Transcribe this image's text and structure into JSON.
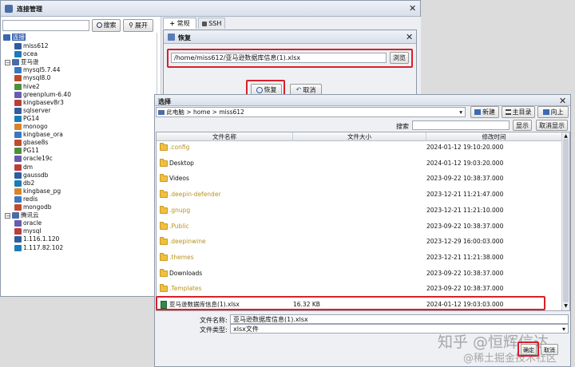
{
  "conn_mgr": {
    "title": "连接管理",
    "search_label": "搜索",
    "expand_label": "展开",
    "search_value": ""
  },
  "tree": {
    "root": "连接",
    "items": [
      {
        "label": "miss612",
        "depth": 1
      },
      {
        "label": "ocea",
        "depth": 1
      },
      {
        "label": "亚马逊",
        "depth": 0,
        "group": true
      },
      {
        "label": "mysql5.7.44",
        "depth": 1
      },
      {
        "label": "mysql8.0",
        "depth": 1
      },
      {
        "label": "hive2",
        "depth": 1
      },
      {
        "label": "greenplum-6.40",
        "depth": 1
      },
      {
        "label": "kingbasev8r3",
        "depth": 1
      },
      {
        "label": "sqlserver",
        "depth": 1
      },
      {
        "label": "PG14",
        "depth": 1
      },
      {
        "label": "monogo",
        "depth": 1
      },
      {
        "label": "kingbase_ora",
        "depth": 1
      },
      {
        "label": "gbase8s",
        "depth": 1
      },
      {
        "label": "PG11",
        "depth": 1
      },
      {
        "label": "oracle19c",
        "depth": 1
      },
      {
        "label": "dm",
        "depth": 1
      },
      {
        "label": "gaussdb",
        "depth": 1
      },
      {
        "label": "db2",
        "depth": 1
      },
      {
        "label": "kingbase_pg",
        "depth": 1
      },
      {
        "label": "redis",
        "depth": 1
      },
      {
        "label": "mongodb",
        "depth": 1
      },
      {
        "label": "腾讯云",
        "depth": 0,
        "group": true
      },
      {
        "label": "oracle",
        "depth": 1
      },
      {
        "label": "mysql",
        "depth": 1
      },
      {
        "label": "1.116.1.120",
        "depth": 1
      },
      {
        "label": "1.117.82.102",
        "depth": 1
      }
    ]
  },
  "tabs": {
    "normal": "常规",
    "ssh": "SSH"
  },
  "restore": {
    "title": "恢复",
    "path_value": "/home/miss612/亚马逊数据库信息(1).xlsx",
    "browse_label": "浏览",
    "restore_label": "恢复",
    "cancel_label": "取消"
  },
  "chooser": {
    "title": "选择",
    "breadcrumb": [
      "此电脑",
      "home",
      "miss612"
    ],
    "new_label": "新建",
    "home_label": "主目录",
    "up_label": "向上",
    "search_label": "搜索",
    "search_value": "",
    "show_label": "显示",
    "cancel_show_label": "取消显示",
    "columns": [
      "文件名称",
      "文件大小",
      "修改时间"
    ],
    "rows": [
      {
        "name": ".config",
        "size": "",
        "date": "2024-01-12 19:10:20.000",
        "hidden": true,
        "file": false
      },
      {
        "name": "Desktop",
        "size": "",
        "date": "2024-01-12 19:03:20.000",
        "hidden": false,
        "file": false
      },
      {
        "name": "Videos",
        "size": "",
        "date": "2023-09-22 10:38:37.000",
        "hidden": false,
        "file": false
      },
      {
        "name": ".deepin-defender",
        "size": "",
        "date": "2023-12-21 11:21:47.000",
        "hidden": true,
        "file": false
      },
      {
        "name": ".gnupg",
        "size": "",
        "date": "2023-12-21 11:21:10.000",
        "hidden": true,
        "file": false
      },
      {
        "name": ".Public",
        "size": "",
        "date": "2023-09-22 10:38:37.000",
        "hidden": true,
        "file": false
      },
      {
        "name": ".deepinwine",
        "size": "",
        "date": "2023-12-29 16:00:03.000",
        "hidden": true,
        "file": false
      },
      {
        "name": ".themes",
        "size": "",
        "date": "2023-12-21 11:21:38.000",
        "hidden": true,
        "file": false
      },
      {
        "name": "Downloads",
        "size": "",
        "date": "2023-09-22 10:38:37.000",
        "hidden": false,
        "file": false
      },
      {
        "name": ".Templates",
        "size": "",
        "date": "2023-09-22 10:38:37.000",
        "hidden": true,
        "file": false
      },
      {
        "name": "亚马逊数据库信息(1).xlsx",
        "size": "16.32 KB",
        "date": "2024-01-12 19:03:03.000",
        "hidden": false,
        "file": true
      }
    ],
    "filename_label": "文件名称:",
    "filename_value": "亚马逊数据库信息(1).xlsx",
    "filetype_label": "文件类型:",
    "filetype_value": "xlsx文件",
    "confirm_label": "确定",
    "cancel_label": "取消"
  },
  "watermark": {
    "line1": "知乎 @恒辉信达",
    "line2": "@稀土掘金技术社区"
  }
}
